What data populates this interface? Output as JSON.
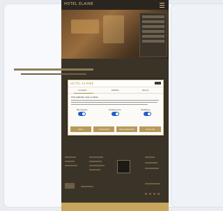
{
  "page": {
    "brand": "HOTEL ELAINE"
  },
  "modal": {
    "logo": "HOTEL ELAINE",
    "tabs": [
      "Consent",
      "Details",
      "About"
    ],
    "title": "This website uses cookies",
    "toggles": [
      {
        "label": "Necessary",
        "on": true
      },
      {
        "label": "Preferences",
        "on": true
      },
      {
        "label": "Statistics",
        "on": true
      }
    ],
    "buttons": [
      "Deny",
      "Customize",
      "Allow selection",
      "Allow all"
    ]
  },
  "colors": {
    "accent": "#b7995a",
    "toggle_on": "#1f5fc4",
    "dark_bg": "#3a3328"
  }
}
